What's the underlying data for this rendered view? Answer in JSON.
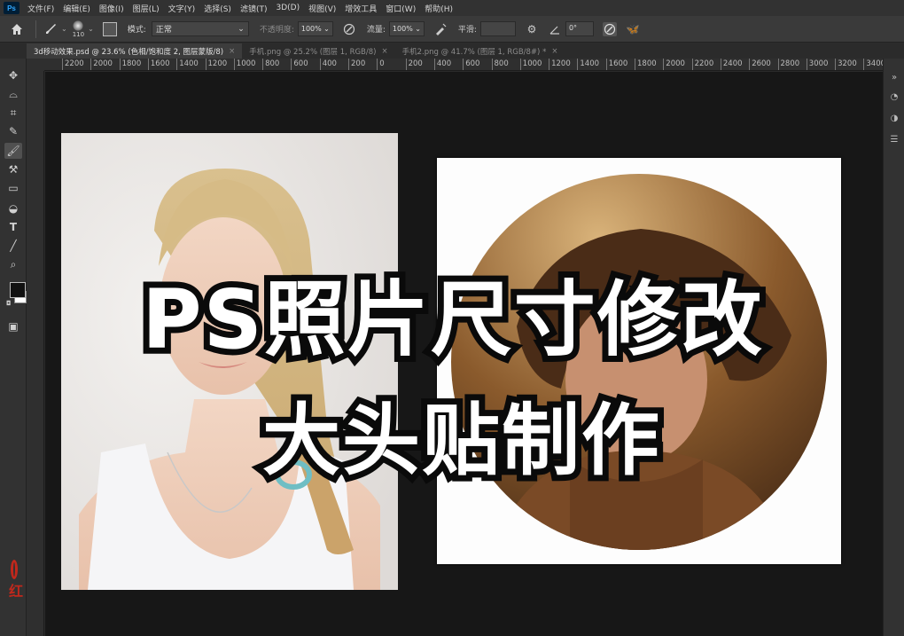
{
  "menu": {
    "logo": "Ps",
    "items": [
      "文件(F)",
      "编辑(E)",
      "图像(I)",
      "图层(L)",
      "文字(Y)",
      "选择(S)",
      "滤镜(T)",
      "3D(D)",
      "视图(V)",
      "增效工具",
      "窗口(W)",
      "帮助(H)"
    ]
  },
  "options": {
    "brush_size": "110",
    "mode_label": "模式:",
    "mode_value": "正常",
    "opacity_label": "不透明度:",
    "opacity_value": "100%",
    "flow_label": "流量:",
    "flow_value": "100%",
    "smooth_label": "平滑:",
    "angle_value": "0°"
  },
  "tabs": [
    {
      "label": "3d移动效果.psd @ 23.6% (色相/饱和度 2, 图层蒙版/8)",
      "active": true
    },
    {
      "label": "手机.png @ 25.2% (图层 1, RGB/8)",
      "active": false
    },
    {
      "label": "手机2.png @ 41.7% (图层 1, RGB/8#) *",
      "active": false
    }
  ],
  "ruler_ticks": [
    "2200",
    "2000",
    "1800",
    "1600",
    "1400",
    "1200",
    "1000",
    "800",
    "600",
    "400",
    "200",
    "0",
    "200",
    "400",
    "600",
    "800",
    "1000",
    "1200",
    "1400",
    "1600",
    "1800",
    "2000",
    "2200",
    "2400",
    "2600",
    "2800",
    "3000",
    "3200",
    "3400"
  ],
  "overlay": {
    "line1": "PS照片尺寸修改",
    "line2": "大头贴制作"
  },
  "left_mark": "红",
  "colors": {
    "accent_ps": "#31a8ff",
    "title_fill": "#ffffff",
    "title_stroke": "#0a0a0a",
    "canvas_bg": "#171717"
  }
}
